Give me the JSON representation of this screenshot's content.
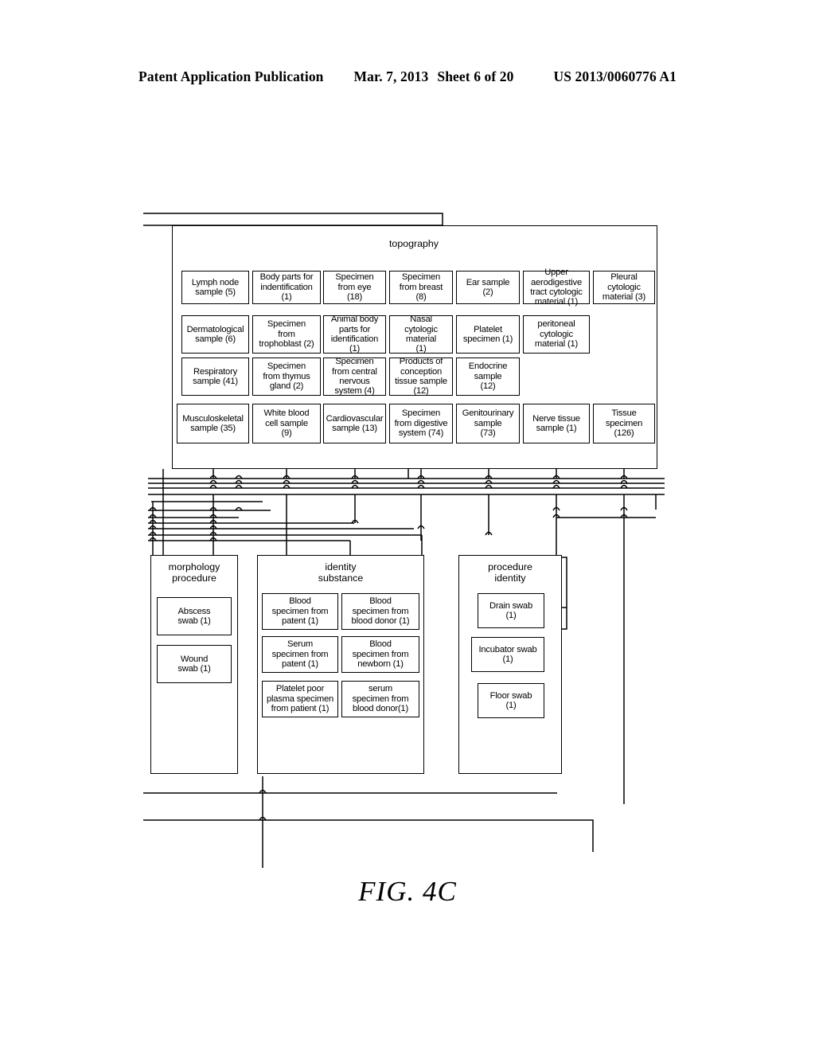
{
  "header": {
    "title": "Patent Application Publication",
    "date": "Mar. 7, 2013",
    "sheet": "Sheet 6 of 20",
    "number": "US 2013/0060776 A1"
  },
  "figure": {
    "label": "FIG.  4C"
  },
  "groups": {
    "topography": {
      "title": "topography",
      "nodes": [
        {
          "label": "Lymph  node\nsample  (5)"
        },
        {
          "label": "Body parts for\nindentification\n(1)"
        },
        {
          "label": "Specimen\nfrom  eye\n(18)"
        },
        {
          "label": "Specimen\nfrom  breast\n(8)"
        },
        {
          "label": "Ear  sample\n(2)"
        },
        {
          "label": "Upper\naerodigestive\ntract  cytologic\nmaterial  (1)"
        },
        {
          "label": "Pleural\ncytologic\nmaterial  (3)"
        },
        {
          "label": "Dermatological\nsample  (6)"
        },
        {
          "label": "Specimen\nfrom\ntrophoblast  (2)"
        },
        {
          "label": "Animal  body\nparts  for\nidentification\n(1)"
        },
        {
          "label": "Nasal\ncytologic\nmaterial\n(1)"
        },
        {
          "label": "Platelet\nspecimen  (1)"
        },
        {
          "label": "peritoneal\ncytologic\nmaterial  (1)"
        },
        {
          "label": "Respiratory\nsample  (41)"
        },
        {
          "label": "Specimen\nfrom  thymus\ngland  (2)"
        },
        {
          "label": "Specimen\nfrom  central\nnervous\nsystem  (4)"
        },
        {
          "label": "Products  of\nconception\ntissue  sample\n(12)"
        },
        {
          "label": "Endocrine\nsample\n(12)"
        },
        {
          "label": "Musculoskeletal\nsample  (35)"
        },
        {
          "label": "White  blood\ncell  sample\n(9)"
        },
        {
          "label": "Cardiovascular\nsample  (13)"
        },
        {
          "label": "Specimen\nfrom  digestive\nsystem  (74)"
        },
        {
          "label": "Genitourinary\nsample\n(73)"
        },
        {
          "label": "Nerve  tissue\nsample  (1)"
        },
        {
          "label": "Tissue\nspecimen\n(126)"
        }
      ]
    },
    "morphology_procedure": {
      "title": "morphology\nprocedure",
      "nodes": [
        {
          "label": "Abscess\nswab  (1)"
        },
        {
          "label": "Wound\nswab  (1)"
        }
      ]
    },
    "identity_substance": {
      "title": "identity\nsubstance",
      "nodes": [
        {
          "label": "Blood\nspecimen  from\npatent  (1)"
        },
        {
          "label": "Blood\nspecimen  from\nblood  donor  (1)"
        },
        {
          "label": "Serum\nspecimen  from\npatent  (1)"
        },
        {
          "label": "Blood\nspecimen  from\nnewborn  (1)"
        },
        {
          "label": "Platelet  poor\nplasma  specimen\nfrom  patient  (1)"
        },
        {
          "label": "serum\nspecimen  from\nblood  donor(1)"
        }
      ]
    },
    "procedure_identity": {
      "title": "procedure\nidentity",
      "nodes": [
        {
          "label": "Drain  swab\n(1)"
        },
        {
          "label": "Incubator  swab\n(1)"
        },
        {
          "label": "Floor  swab\n(1)"
        }
      ]
    }
  },
  "colors": {
    "line": "#000000",
    "background": "#ffffff"
  }
}
